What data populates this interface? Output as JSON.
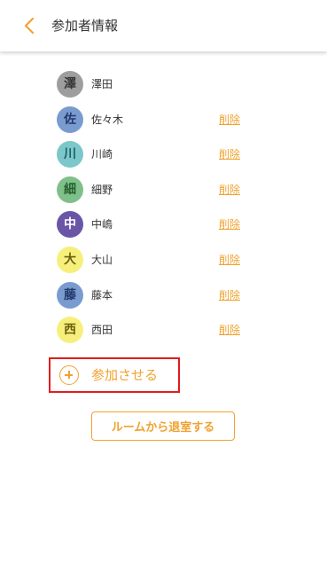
{
  "header": {
    "title": "参加者情報",
    "back_icon": "chevron-left-icon"
  },
  "colors": {
    "accent": "#f0a22e",
    "highlight_border": "#e31b1b"
  },
  "participants": [
    {
      "avatar_char": "澤",
      "name": "澤田",
      "avatar_bg": "#9e9e9e",
      "avatar_fg": "#333333",
      "delete_label": ""
    },
    {
      "avatar_char": "佐",
      "name": "佐々木",
      "avatar_bg": "#7a9bd0",
      "avatar_fg": "#233a6b",
      "delete_label": "削除"
    },
    {
      "avatar_char": "川",
      "name": "川崎",
      "avatar_bg": "#7cc7c9",
      "avatar_fg": "#1f5f61",
      "delete_label": "削除"
    },
    {
      "avatar_char": "細",
      "name": "細野",
      "avatar_bg": "#7fc08a",
      "avatar_fg": "#25602f",
      "delete_label": "削除"
    },
    {
      "avatar_char": "中",
      "name": "中嶋",
      "avatar_bg": "#6b55a6",
      "avatar_fg": "#ffffff",
      "delete_label": "削除"
    },
    {
      "avatar_char": "大",
      "name": "大山",
      "avatar_bg": "#f7ef7c",
      "avatar_fg": "#6b5f12",
      "delete_label": "削除"
    },
    {
      "avatar_char": "藤",
      "name": "藤本",
      "avatar_bg": "#7a9bd0",
      "avatar_fg": "#233a6b",
      "delete_label": "削除"
    },
    {
      "avatar_char": "西",
      "name": "西田",
      "avatar_bg": "#f7ef7c",
      "avatar_fg": "#6b5f12",
      "delete_label": "削除"
    }
  ],
  "add_member": {
    "label": "参加させる",
    "icon": "plus-circle-icon"
  },
  "leave_button": {
    "label": "ルームから退室する"
  }
}
